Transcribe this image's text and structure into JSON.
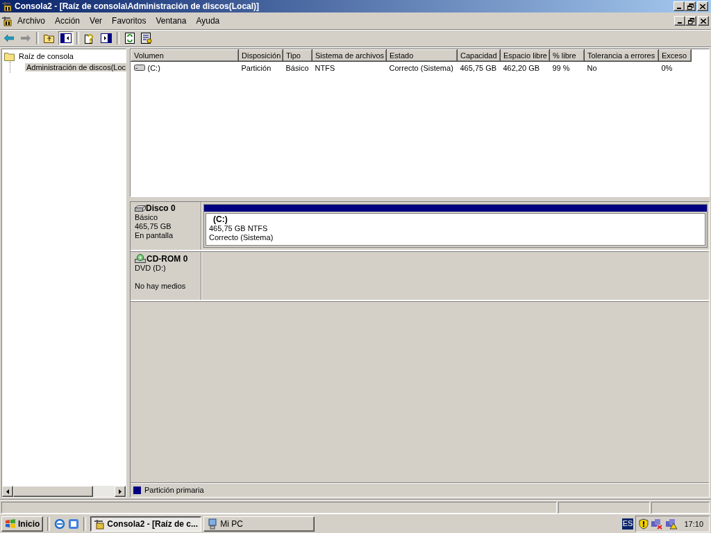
{
  "window": {
    "title": "Consola2 - [Raíz de consola\\Administración de discos(Local)]"
  },
  "menu": [
    "Archivo",
    "Acción",
    "Ver",
    "Favoritos",
    "Ventana",
    "Ayuda"
  ],
  "tree": [
    {
      "label": "Raíz de consola",
      "selected": false,
      "children": [
        {
          "label": "Administración de discos(Loc",
          "selected": true
        }
      ]
    }
  ],
  "volume_table": {
    "columns": [
      "Volumen",
      "Disposición",
      "Tipo",
      "Sistema de archivos",
      "Estado",
      "Capacidad",
      "Espacio libre",
      "% libre",
      "Tolerancia a errores",
      "Exceso"
    ],
    "rows": [
      {
        "cells": [
          "(C:)",
          "Partición",
          "Básico",
          "NTFS",
          "Correcto (Sistema)",
          "465,75 GB",
          "462,20 GB",
          "99 %",
          "No",
          "0%"
        ]
      }
    ]
  },
  "disks": [
    {
      "kind": "disk",
      "name": "Disco 0",
      "type": "Básico",
      "size": "465,75 GB",
      "status": "En pantalla",
      "partitions": [
        {
          "label": "(C:)",
          "size": "465,75 GB NTFS",
          "status": "Correcto (Sistema)",
          "color": "#000080"
        }
      ]
    },
    {
      "kind": "cdrom",
      "name": "CD-ROM 0",
      "type": "DVD (D:)",
      "status": "No hay medios"
    }
  ],
  "legend": [
    {
      "label": "Partición primaria",
      "color": "#000080"
    }
  ],
  "taskbar": {
    "start": "Inicio",
    "tasks": [
      {
        "label": "Consola2 - [Raíz de c...",
        "selected": true
      },
      {
        "label": "Mi PC",
        "selected": false
      }
    ],
    "language": "ES",
    "clock": "17:10"
  }
}
